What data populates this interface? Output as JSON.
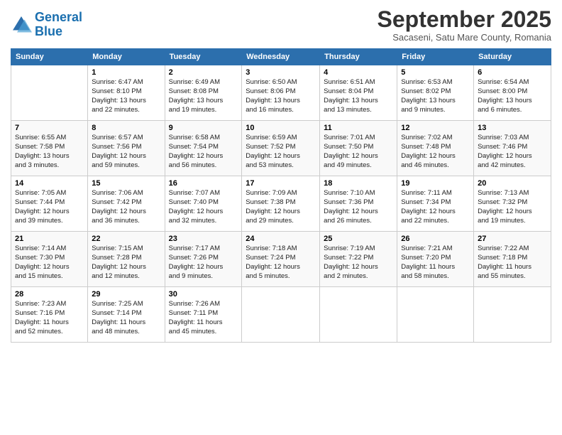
{
  "header": {
    "logo_line1": "General",
    "logo_line2": "Blue",
    "month_title": "September 2025",
    "location": "Sacaseni, Satu Mare County, Romania"
  },
  "days_of_week": [
    "Sunday",
    "Monday",
    "Tuesday",
    "Wednesday",
    "Thursday",
    "Friday",
    "Saturday"
  ],
  "weeks": [
    [
      {
        "day": "",
        "info": ""
      },
      {
        "day": "1",
        "info": "Sunrise: 6:47 AM\nSunset: 8:10 PM\nDaylight: 13 hours\nand 22 minutes."
      },
      {
        "day": "2",
        "info": "Sunrise: 6:49 AM\nSunset: 8:08 PM\nDaylight: 13 hours\nand 19 minutes."
      },
      {
        "day": "3",
        "info": "Sunrise: 6:50 AM\nSunset: 8:06 PM\nDaylight: 13 hours\nand 16 minutes."
      },
      {
        "day": "4",
        "info": "Sunrise: 6:51 AM\nSunset: 8:04 PM\nDaylight: 13 hours\nand 13 minutes."
      },
      {
        "day": "5",
        "info": "Sunrise: 6:53 AM\nSunset: 8:02 PM\nDaylight: 13 hours\nand 9 minutes."
      },
      {
        "day": "6",
        "info": "Sunrise: 6:54 AM\nSunset: 8:00 PM\nDaylight: 13 hours\nand 6 minutes."
      }
    ],
    [
      {
        "day": "7",
        "info": "Sunrise: 6:55 AM\nSunset: 7:58 PM\nDaylight: 13 hours\nand 3 minutes."
      },
      {
        "day": "8",
        "info": "Sunrise: 6:57 AM\nSunset: 7:56 PM\nDaylight: 12 hours\nand 59 minutes."
      },
      {
        "day": "9",
        "info": "Sunrise: 6:58 AM\nSunset: 7:54 PM\nDaylight: 12 hours\nand 56 minutes."
      },
      {
        "day": "10",
        "info": "Sunrise: 6:59 AM\nSunset: 7:52 PM\nDaylight: 12 hours\nand 53 minutes."
      },
      {
        "day": "11",
        "info": "Sunrise: 7:01 AM\nSunset: 7:50 PM\nDaylight: 12 hours\nand 49 minutes."
      },
      {
        "day": "12",
        "info": "Sunrise: 7:02 AM\nSunset: 7:48 PM\nDaylight: 12 hours\nand 46 minutes."
      },
      {
        "day": "13",
        "info": "Sunrise: 7:03 AM\nSunset: 7:46 PM\nDaylight: 12 hours\nand 42 minutes."
      }
    ],
    [
      {
        "day": "14",
        "info": "Sunrise: 7:05 AM\nSunset: 7:44 PM\nDaylight: 12 hours\nand 39 minutes."
      },
      {
        "day": "15",
        "info": "Sunrise: 7:06 AM\nSunset: 7:42 PM\nDaylight: 12 hours\nand 36 minutes."
      },
      {
        "day": "16",
        "info": "Sunrise: 7:07 AM\nSunset: 7:40 PM\nDaylight: 12 hours\nand 32 minutes."
      },
      {
        "day": "17",
        "info": "Sunrise: 7:09 AM\nSunset: 7:38 PM\nDaylight: 12 hours\nand 29 minutes."
      },
      {
        "day": "18",
        "info": "Sunrise: 7:10 AM\nSunset: 7:36 PM\nDaylight: 12 hours\nand 26 minutes."
      },
      {
        "day": "19",
        "info": "Sunrise: 7:11 AM\nSunset: 7:34 PM\nDaylight: 12 hours\nand 22 minutes."
      },
      {
        "day": "20",
        "info": "Sunrise: 7:13 AM\nSunset: 7:32 PM\nDaylight: 12 hours\nand 19 minutes."
      }
    ],
    [
      {
        "day": "21",
        "info": "Sunrise: 7:14 AM\nSunset: 7:30 PM\nDaylight: 12 hours\nand 15 minutes."
      },
      {
        "day": "22",
        "info": "Sunrise: 7:15 AM\nSunset: 7:28 PM\nDaylight: 12 hours\nand 12 minutes."
      },
      {
        "day": "23",
        "info": "Sunrise: 7:17 AM\nSunset: 7:26 PM\nDaylight: 12 hours\nand 9 minutes."
      },
      {
        "day": "24",
        "info": "Sunrise: 7:18 AM\nSunset: 7:24 PM\nDaylight: 12 hours\nand 5 minutes."
      },
      {
        "day": "25",
        "info": "Sunrise: 7:19 AM\nSunset: 7:22 PM\nDaylight: 12 hours\nand 2 minutes."
      },
      {
        "day": "26",
        "info": "Sunrise: 7:21 AM\nSunset: 7:20 PM\nDaylight: 11 hours\nand 58 minutes."
      },
      {
        "day": "27",
        "info": "Sunrise: 7:22 AM\nSunset: 7:18 PM\nDaylight: 11 hours\nand 55 minutes."
      }
    ],
    [
      {
        "day": "28",
        "info": "Sunrise: 7:23 AM\nSunset: 7:16 PM\nDaylight: 11 hours\nand 52 minutes."
      },
      {
        "day": "29",
        "info": "Sunrise: 7:25 AM\nSunset: 7:14 PM\nDaylight: 11 hours\nand 48 minutes."
      },
      {
        "day": "30",
        "info": "Sunrise: 7:26 AM\nSunset: 7:11 PM\nDaylight: 11 hours\nand 45 minutes."
      },
      {
        "day": "",
        "info": ""
      },
      {
        "day": "",
        "info": ""
      },
      {
        "day": "",
        "info": ""
      },
      {
        "day": "",
        "info": ""
      }
    ]
  ]
}
